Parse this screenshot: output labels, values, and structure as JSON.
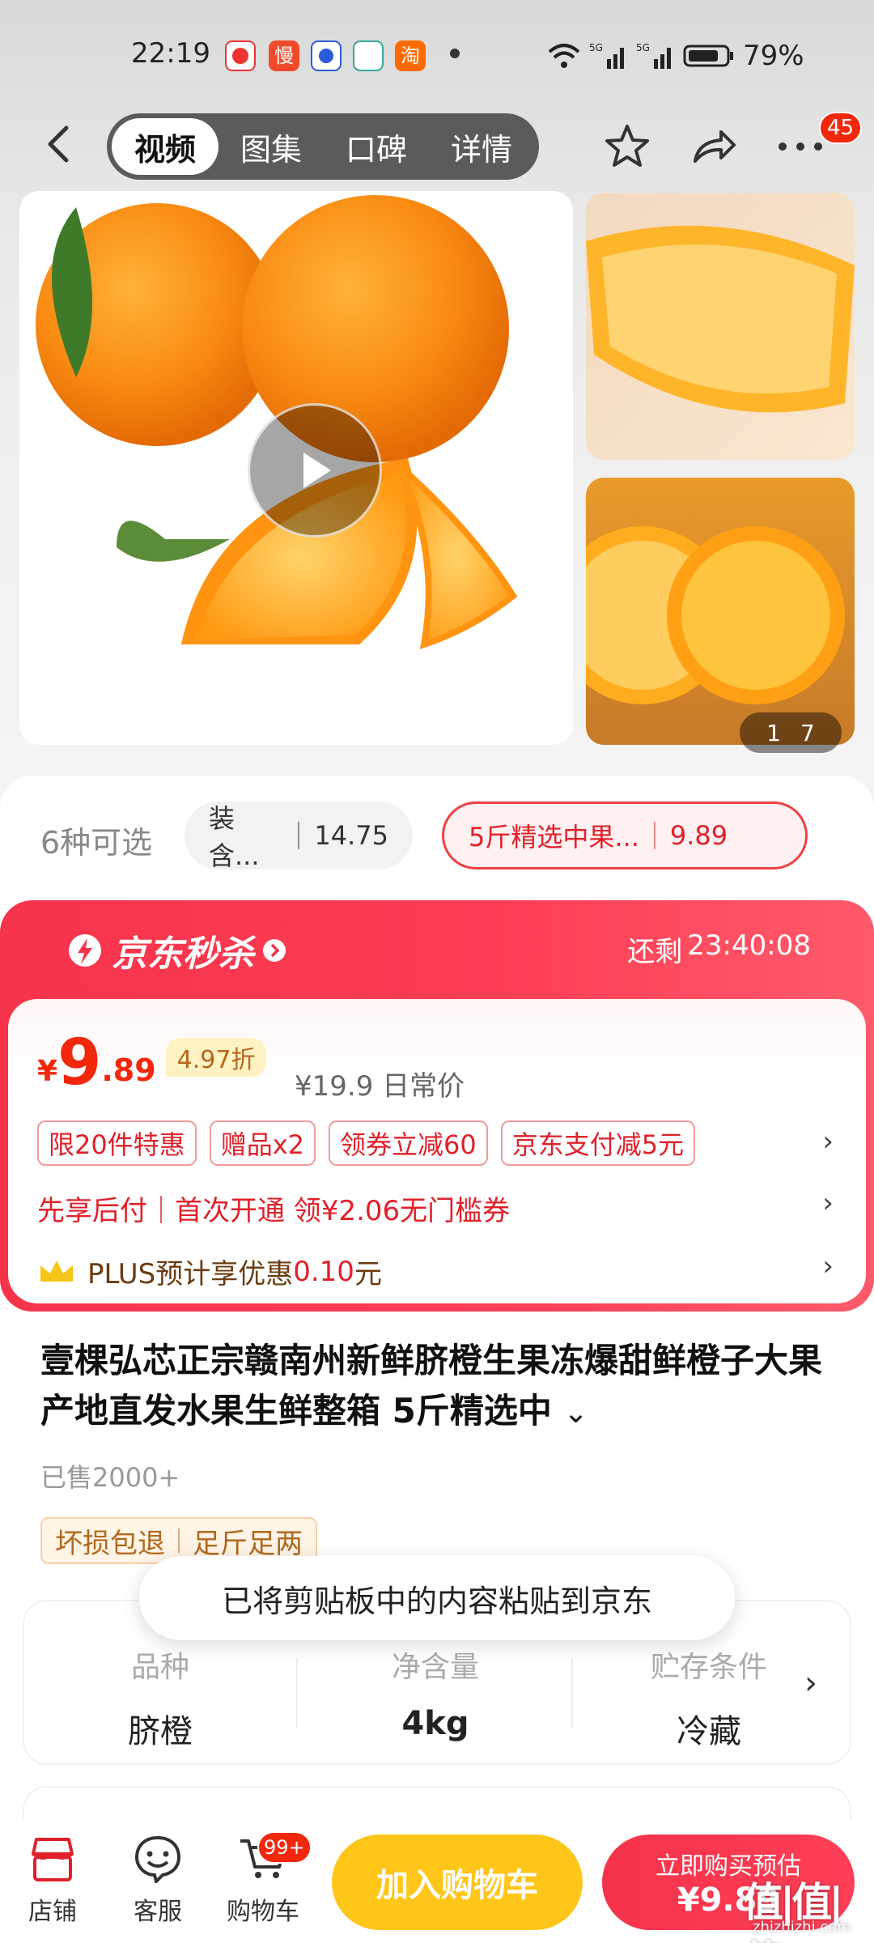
{
  "status_bar": {
    "time": "22:19",
    "battery": "79%",
    "network": "5G",
    "app_icons": [
      "jd-icon",
      "jd-express-icon",
      "baidu-icon",
      "health-icon",
      "taobao-icon"
    ]
  },
  "nav": {
    "tabs": [
      {
        "label": "视频",
        "active": true
      },
      {
        "label": "图集",
        "active": false
      },
      {
        "label": "口碑",
        "active": false
      },
      {
        "label": "详情",
        "active": false
      }
    ],
    "message_badge": "45"
  },
  "gallery": {
    "counter_current": "1",
    "counter_total": "7"
  },
  "variants": {
    "count_label": "6种可选",
    "options": [
      {
        "label": "装含...",
        "price": "14.75",
        "selected": false
      },
      {
        "label": "5斤精选中果...",
        "price": "9.89",
        "selected": true
      }
    ]
  },
  "flash_sale": {
    "title": "京东秒杀",
    "countdown_label": "还剩",
    "countdown": "23:40:08",
    "currency": "¥",
    "price_int": "9",
    "price_dec": ".89",
    "discount": "4.97折",
    "original_price": "¥19.9 日常价",
    "tags": [
      "限20件特惠",
      "赠品x2",
      "领券立减60",
      "京东支付减5元"
    ],
    "credit_line": "先享后付｜首次开通 领¥2.06无门槛券",
    "plus_prefix": "PLUS预计享优惠",
    "plus_amount": "0.10",
    "plus_suffix": "元"
  },
  "product": {
    "title": "壹棵弘芯正宗赣南州新鲜脐橙生果冻爆甜鲜橙子大果产地直发水果生鲜整箱 5斤精选中",
    "sold": "已售2000+",
    "guarantees": [
      "坏损包退",
      "足斤足两"
    ]
  },
  "specs": [
    {
      "key": "品种",
      "value": "脐橙"
    },
    {
      "key": "净含量",
      "value": "4kg"
    },
    {
      "key": "贮存条件",
      "value": "冷藏"
    }
  ],
  "toast": "已将剪贴板中的内容粘贴到京东",
  "bottom_bar": {
    "store": "店铺",
    "service": "客服",
    "cart": "购物车",
    "cart_badge": "99+",
    "add_to_cart": "加入购物车",
    "buy_now": "立即购买预估",
    "buy_price": "¥9.89"
  },
  "watermark": {
    "main": "值|值|值",
    "sub": "zhizhizhi.com"
  },
  "colors": {
    "accent": "#f2270c",
    "flash_red": "#f5334a",
    "cart_yellow": "#ffc61a"
  }
}
